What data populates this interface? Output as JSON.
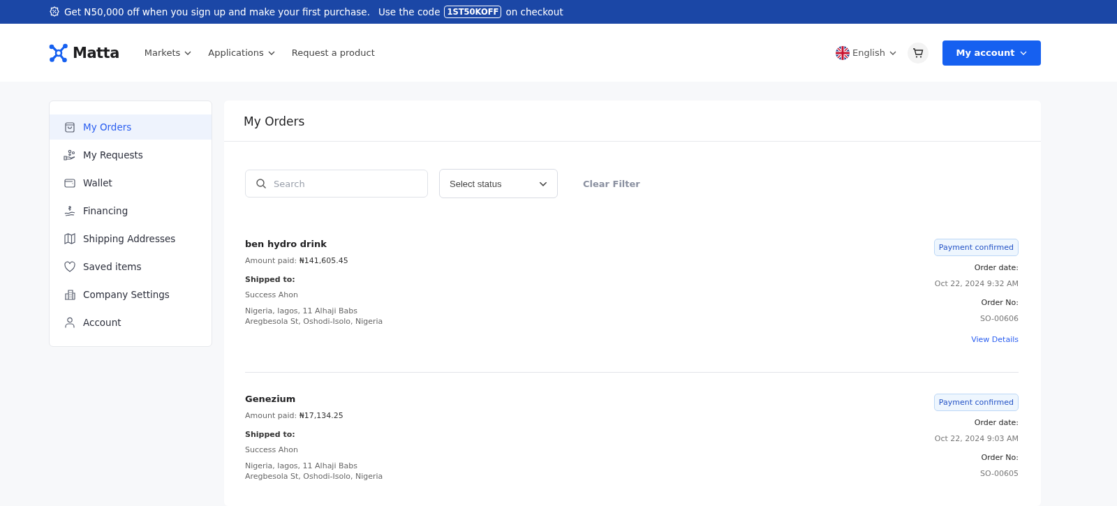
{
  "promo_banner": {
    "text_before": "Get N50,000 off when you sign up and make your first purchase.",
    "text_code_intro": "Use the code",
    "code": "1ST50KOFF",
    "text_after": "on checkout"
  },
  "header": {
    "logo": "Matta",
    "nav": [
      {
        "label": "Markets",
        "dropdown": true
      },
      {
        "label": "Applications",
        "dropdown": true
      },
      {
        "label": "Request a product",
        "dropdown": false
      }
    ],
    "language": "English",
    "account_button": "My account"
  },
  "sidebar": {
    "items": [
      {
        "label": "My Orders",
        "selected": true
      },
      {
        "label": "My Requests",
        "selected": false
      },
      {
        "label": "Wallet",
        "selected": false
      },
      {
        "label": "Financing",
        "selected": false
      },
      {
        "label": "Shipping Addresses",
        "selected": false
      },
      {
        "label": "Saved items",
        "selected": false
      },
      {
        "label": "Company Settings",
        "selected": false
      },
      {
        "label": "Account",
        "selected": false
      }
    ]
  },
  "main": {
    "title": "My Orders",
    "search": {
      "placeholder": "Search"
    },
    "status_select": "Select status",
    "clear_filter": "Clear Filter",
    "orders": [
      {
        "name": "ben hydro drink",
        "amount_label": "Amount paid:",
        "amount": "₦141,605.45",
        "shipped_label": "Shipped to:",
        "recipient": "Success Ahon",
        "address": "Nigeria, lagos, 11 Alhaji Babs Aregbesola St, Oshodi-Isolo, Nigeria",
        "status": "Payment confirmed",
        "date_label": "Order date:",
        "date": "Oct 22, 2024 9:32 AM",
        "number_label": "Order No:",
        "number": "SO-00606",
        "details_link": "View Details"
      },
      {
        "name": "Genezium",
        "amount_label": "Amount paid:",
        "amount": "₦17,134.25",
        "shipped_label": "Shipped to:",
        "recipient": "Success Ahon",
        "address": "Nigeria, lagos, 11 Alhaji Babs Aregbesola St, Oshodi-Isolo, Nigeria",
        "status": "Payment confirmed",
        "date_label": "Order date:",
        "date": "Oct 22, 2024 9:03 AM",
        "number_label": "Order No:",
        "number": "SO-00605"
      }
    ]
  }
}
